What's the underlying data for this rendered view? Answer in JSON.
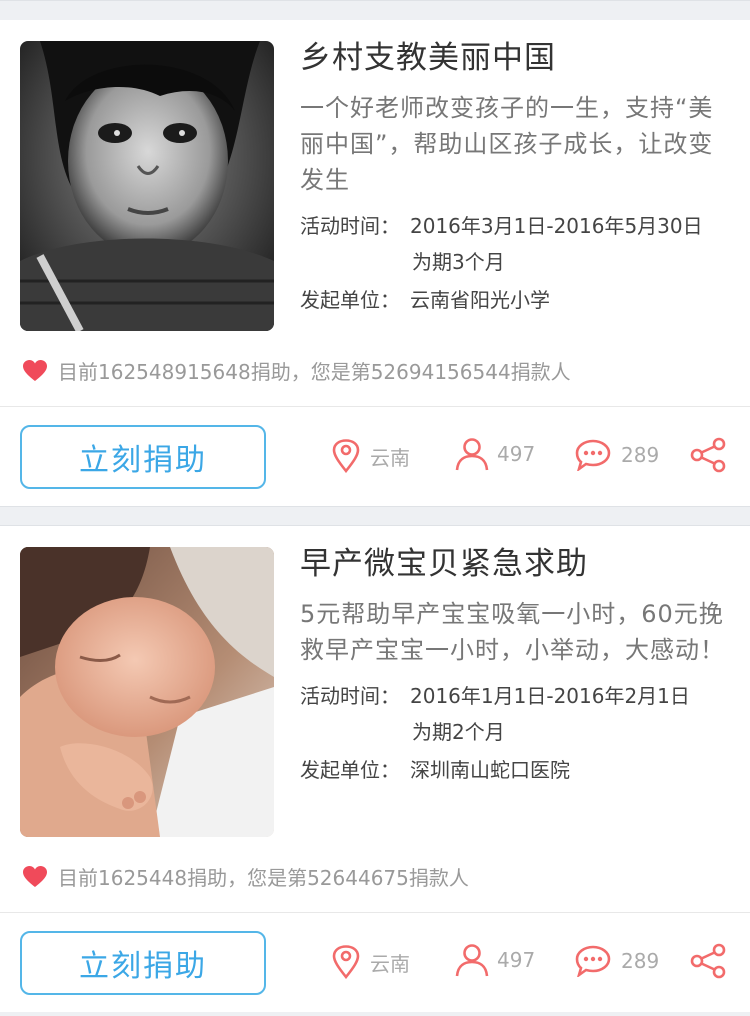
{
  "cards": [
    {
      "title": "乡村支教美丽中国",
      "description": "一个好老师改变孩子的一生，支持“美丽中国”，帮助山区孩子成长，让改变发生",
      "time_key": "活动时间：",
      "time_value": "2016年3月1日-2016年5月30日",
      "duration": "为期3个月",
      "org_key": "发起单位：",
      "org_value": "云南省阳光小学",
      "donation_text": "目前162548915648捐助，您是第52694156544捐款人",
      "donate_label": "立刻捐助",
      "location": "云南",
      "participants": "497",
      "comments": "289",
      "image": "girl-portrait"
    },
    {
      "title": "早产微宝贝紧急求助",
      "description": "5元帮助早产宝宝吸氧一小时，60元挽救早产宝宝一小时，小举动，大感动！",
      "time_key": "活动时间：",
      "time_value": "2016年1月1日-2016年2月1日",
      "duration": "为期2个月",
      "org_key": "发起单位：",
      "org_value": "深圳南山蛇口医院",
      "donation_text": "目前1625448捐助，您是第52644675捐款人",
      "donate_label": "立刻捐助",
      "location": "云南",
      "participants": "497",
      "comments": "289",
      "image": "newborn-baby"
    }
  ],
  "colors": {
    "accent_blue": "#3ba7e6",
    "icon_red": "#f26b6b",
    "heart": "#f04a5a"
  },
  "icons": [
    "heart-icon",
    "location-pin-icon",
    "person-icon",
    "chat-bubble-icon",
    "share-icon"
  ]
}
